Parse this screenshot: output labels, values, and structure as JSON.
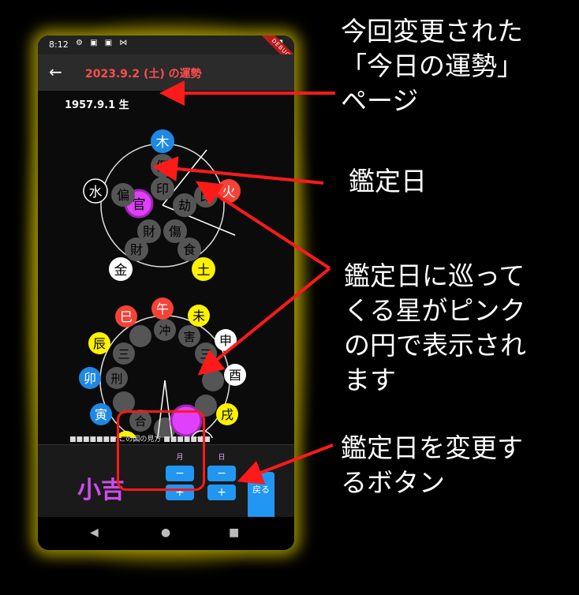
{
  "status": {
    "time": "8:12",
    "icons": "⚙ ▣ ▣ ⋈",
    "signal": "▾◢▮",
    "debug": "DEBUG"
  },
  "appbar": {
    "back": "←",
    "title": "2023.9.2 (土) の運勢"
  },
  "birth": "1957.9.1 生",
  "chart1": {
    "center_items": [
      "倒",
      "印",
      "官",
      "劫",
      "比",
      "財",
      "傷",
      "財",
      "食",
      "偏"
    ],
    "outer": [
      {
        "label": "木",
        "color": "#1e88e5",
        "text": "#fff"
      },
      {
        "label": "火",
        "color": "#f44336",
        "text": "#fff"
      },
      {
        "label": "土",
        "color": "#fff200",
        "text": "#000"
      },
      {
        "label": "金",
        "color": "#ffffff",
        "text": "#000"
      },
      {
        "label": "水",
        "color": "#000000",
        "text": "#fff"
      }
    ],
    "highlight": "官"
  },
  "chart2": {
    "zodiac": [
      {
        "label": "午",
        "color": "#f44336",
        "text": "#fff"
      },
      {
        "label": "未",
        "color": "#fff200",
        "text": "#000"
      },
      {
        "label": "申",
        "color": "#ffffff",
        "text": "#000"
      },
      {
        "label": "酉",
        "color": "#ffffff",
        "text": "#000"
      },
      {
        "label": "戌",
        "color": "#fff200",
        "text": "#000"
      },
      {
        "label": "亥",
        "color": "#000000",
        "text": "#fff"
      },
      {
        "label": "子",
        "color": "#000000",
        "text": "#fff"
      },
      {
        "label": "丑",
        "color": "#fff200",
        "text": "#000"
      },
      {
        "label": "寅",
        "color": "#1e88e5",
        "text": "#fff"
      },
      {
        "label": "卯",
        "color": "#1e88e5",
        "text": "#fff"
      },
      {
        "label": "辰",
        "color": "#fff200",
        "text": "#000"
      },
      {
        "label": "巳",
        "color": "#f44336",
        "text": "#fff"
      }
    ],
    "inner": [
      "冲",
      "害",
      "三",
      "三",
      "刑",
      "合"
    ]
  },
  "legend": "■■■■■■■ この図の見方 ■■■■■■■",
  "fortune": "小吉",
  "controls": {
    "month_label": "月",
    "day_label": "日",
    "minus": "−",
    "plus": "+",
    "back_label": "戻る"
  },
  "navbar": {
    "back": "◀",
    "home": "●",
    "recent": "■"
  },
  "annotations": {
    "page": [
      "今回変更された",
      "「今日の運勢」",
      "ページ"
    ],
    "date": "鑑定日",
    "star": [
      "鑑定日に巡って",
      "くる星がピンク",
      "の円で表示され",
      "ます"
    ],
    "button": [
      "鑑定日を変更す",
      "るボタン"
    ]
  },
  "colors": {
    "accent": "#ff4d4d",
    "pink": "#e040fb",
    "blue": "#2196f3",
    "annotation_arrow": "#ff1a1a"
  }
}
